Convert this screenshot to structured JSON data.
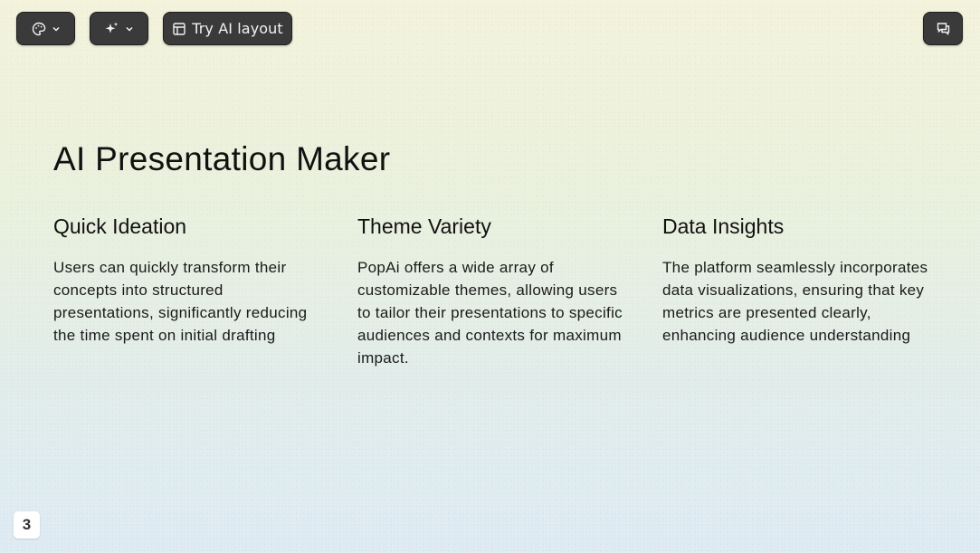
{
  "toolbar": {
    "theme_icon": "palette-icon",
    "ai_icon": "sparkles-icon",
    "layout_icon": "layout-icon",
    "layout_label": "Try AI layout",
    "chat_icon": "chat-icon",
    "button_bg": "#3a3a3a"
  },
  "slide": {
    "title": "AI Presentation Maker",
    "columns": [
      {
        "heading": "Quick Ideation",
        "text": "Users can quickly transform their concepts into structured presentations, significantly reducing the time spent on initial drafting"
      },
      {
        "heading": "Theme Variety",
        "text": "PopAi offers a wide array of customizable themes, allowing users to tailor their presentations to specific audiences and contexts for maximum impact."
      },
      {
        "heading": "Data Insights",
        "text": "The platform seamlessly incorporates data visualizations, ensuring that key metrics are presented clearly, enhancing audience understanding"
      }
    ]
  },
  "page_number": "3"
}
